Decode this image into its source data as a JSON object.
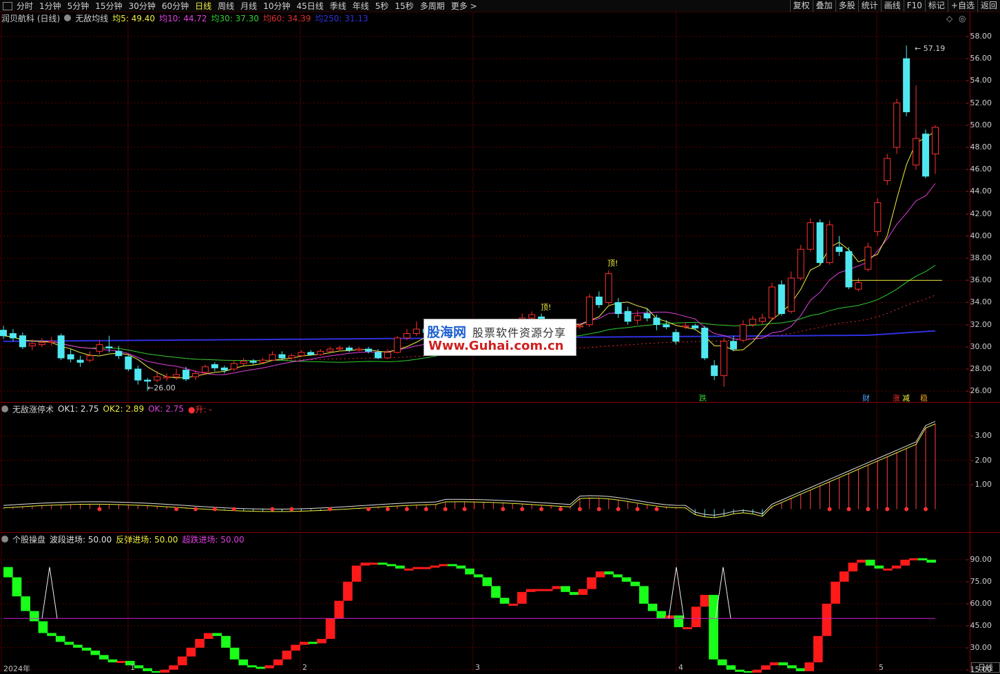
{
  "toolbar": {
    "periods": [
      "分时",
      "1分钟",
      "5分钟",
      "15分钟",
      "30分钟",
      "60分钟",
      "日线",
      "周线",
      "月线",
      "10分钟",
      "45日线",
      "季线",
      "年线",
      "5秒",
      "15秒",
      "多周期",
      "更多 >"
    ],
    "active_period": "日线",
    "tools": [
      "复权",
      "叠加",
      "多股",
      "统计",
      "画线",
      "F10",
      "标记",
      "+自选",
      "返回"
    ]
  },
  "main_panel": {
    "stock": "润贝航科 (日线)",
    "indicator": "无敌均线",
    "ma": [
      {
        "label": "均5: 49.40",
        "color": "#f0f040"
      },
      {
        "label": "均10: 44.72",
        "color": "#e040e0"
      },
      {
        "label": "均30: 37.30",
        "color": "#30d030"
      },
      {
        "label": "均60: 34.39",
        "color": "#e03030"
      },
      {
        "label": "均250: 31.13",
        "color": "#3030e0"
      }
    ],
    "price_axis": [
      "58.00",
      "56.00",
      "54.00",
      "52.00",
      "50.00",
      "48.00",
      "46.00",
      "44.00",
      "42.00",
      "40.00",
      "38.00",
      "36.00",
      "34.00",
      "32.00",
      "30.00",
      "28.00",
      "26.00"
    ],
    "high_label": "57.19",
    "low_label": "26.00",
    "signals": {
      "top": "顶!",
      "down": "跌",
      "cai": "财",
      "zhang": "涨",
      "jian": "减",
      "chou": "稳"
    },
    "period_label": "日线"
  },
  "panel2": {
    "name": "无敌涨停术",
    "ok1": "OK1: 2.75",
    "ok2": "OK2: 2.89",
    "ok": "OK: 2.75",
    "sheng": "●升: -",
    "axis": [
      "3.00",
      "2.00",
      "1.00"
    ]
  },
  "panel3": {
    "name": "个股操盘",
    "wave": "波段进场: 50.00",
    "rebound": "反弹进场: 50.00",
    "oversold": "超跌进场: 50.00",
    "axis": [
      "90.00",
      "75.00",
      "60.00",
      "45.00",
      "30.00",
      "15.00"
    ]
  },
  "dates": [
    "2024年",
    "1",
    "2",
    "3",
    "4",
    "5"
  ],
  "watermark": {
    "brand": "股海网",
    "tag": "股票软件资源分享",
    "url": "Www.Guhai.com.cn"
  },
  "colors": {
    "up": "#ff3030",
    "down": "#50e8f0",
    "ma5": "#f0f040",
    "ma10": "#e040e0",
    "ma30": "#30d030",
    "ma60": "#e03030",
    "ma250": "#3030e0",
    "grid": "#5a0000"
  },
  "chart_data": {
    "type": "candlestick",
    "ylim": [
      25,
      59
    ],
    "candles": [
      {
        "o": 31.5,
        "c": 31.0,
        "h": 31.9,
        "l": 30.7
      },
      {
        "o": 31.2,
        "c": 30.8,
        "h": 31.6,
        "l": 30.5
      },
      {
        "o": 31.0,
        "c": 30.0,
        "h": 31.3,
        "l": 29.8
      },
      {
        "o": 30.1,
        "c": 30.3,
        "h": 30.7,
        "l": 29.7
      },
      {
        "o": 30.2,
        "c": 30.4,
        "h": 30.8,
        "l": 30.0
      },
      {
        "o": 30.4,
        "c": 30.5,
        "h": 30.9,
        "l": 30.1
      },
      {
        "o": 31.0,
        "c": 29.0,
        "h": 31.2,
        "l": 28.8
      },
      {
        "o": 29.3,
        "c": 28.9,
        "h": 29.8,
        "l": 28.6
      },
      {
        "o": 28.8,
        "c": 28.6,
        "h": 29.2,
        "l": 28.2
      },
      {
        "o": 28.8,
        "c": 29.2,
        "h": 29.6,
        "l": 28.6
      },
      {
        "o": 29.6,
        "c": 30.2,
        "h": 30.6,
        "l": 29.3
      },
      {
        "o": 30.0,
        "c": 29.9,
        "h": 31.0,
        "l": 29.5
      },
      {
        "o": 29.6,
        "c": 29.2,
        "h": 30.1,
        "l": 28.9
      },
      {
        "o": 29.1,
        "c": 28.0,
        "h": 29.3,
        "l": 27.8
      },
      {
        "o": 28.0,
        "c": 27.0,
        "h": 28.3,
        "l": 26.6
      },
      {
        "o": 27.0,
        "c": 26.9,
        "h": 27.2,
        "l": 26.0
      },
      {
        "o": 27.0,
        "c": 27.3,
        "h": 27.8,
        "l": 26.8
      },
      {
        "o": 27.2,
        "c": 27.3,
        "h": 27.6,
        "l": 26.9
      },
      {
        "o": 27.3,
        "c": 27.5,
        "h": 28.0,
        "l": 27.0
      },
      {
        "o": 27.9,
        "c": 27.1,
        "h": 28.2,
        "l": 26.9
      },
      {
        "o": 27.3,
        "c": 27.6,
        "h": 27.9,
        "l": 27.0
      },
      {
        "o": 27.7,
        "c": 28.2,
        "h": 28.4,
        "l": 27.5
      },
      {
        "o": 28.4,
        "c": 28.1,
        "h": 28.6,
        "l": 27.8
      },
      {
        "o": 28.1,
        "c": 27.9,
        "h": 28.3,
        "l": 27.6
      },
      {
        "o": 28.0,
        "c": 28.5,
        "h": 28.8,
        "l": 27.8
      },
      {
        "o": 28.5,
        "c": 28.7,
        "h": 29.0,
        "l": 28.3
      },
      {
        "o": 28.7,
        "c": 28.6,
        "h": 28.9,
        "l": 28.4
      },
      {
        "o": 28.6,
        "c": 28.8,
        "h": 29.0,
        "l": 28.5
      },
      {
        "o": 28.8,
        "c": 29.3,
        "h": 29.6,
        "l": 28.7
      },
      {
        "o": 29.3,
        "c": 29.0,
        "h": 29.6,
        "l": 28.8
      },
      {
        "o": 29.0,
        "c": 29.2,
        "h": 29.4,
        "l": 28.9
      },
      {
        "o": 29.2,
        "c": 29.5,
        "h": 29.7,
        "l": 29.1
      },
      {
        "o": 29.5,
        "c": 29.3,
        "h": 29.7,
        "l": 29.2
      },
      {
        "o": 29.3,
        "c": 29.6,
        "h": 29.8,
        "l": 29.2
      },
      {
        "o": 29.6,
        "c": 29.8,
        "h": 30.0,
        "l": 29.5
      },
      {
        "o": 29.8,
        "c": 29.9,
        "h": 30.1,
        "l": 29.6
      },
      {
        "o": 29.9,
        "c": 29.7,
        "h": 30.1,
        "l": 29.5
      },
      {
        "o": 29.7,
        "c": 29.8,
        "h": 30.0,
        "l": 29.6
      },
      {
        "o": 29.8,
        "c": 29.6,
        "h": 30.0,
        "l": 29.4
      },
      {
        "o": 29.5,
        "c": 29.0,
        "h": 29.8,
        "l": 28.9
      },
      {
        "o": 29.0,
        "c": 29.5,
        "h": 29.8,
        "l": 28.9
      },
      {
        "o": 29.5,
        "c": 30.8,
        "h": 31.0,
        "l": 29.4
      },
      {
        "o": 30.8,
        "c": 31.2,
        "h": 31.6,
        "l": 30.6
      },
      {
        "o": 31.2,
        "c": 31.6,
        "h": 32.3,
        "l": 31.0
      },
      {
        "o": 31.6,
        "c": 31.3,
        "h": 31.9,
        "l": 31.1
      },
      {
        "o": 31.3,
        "c": 31.5,
        "h": 31.8,
        "l": 31.1
      },
      {
        "o": 31.5,
        "c": 31.4,
        "h": 31.7,
        "l": 31.2
      },
      {
        "o": 31.4,
        "c": 31.6,
        "h": 31.9,
        "l": 31.2
      },
      {
        "o": 31.6,
        "c": 31.3,
        "h": 31.8,
        "l": 31.1
      },
      {
        "o": 31.3,
        "c": 31.5,
        "h": 31.8,
        "l": 31.2
      },
      {
        "o": 31.5,
        "c": 31.7,
        "h": 32.0,
        "l": 31.3
      },
      {
        "o": 31.7,
        "c": 31.6,
        "h": 31.9,
        "l": 31.4
      },
      {
        "o": 31.6,
        "c": 31.8,
        "h": 32.0,
        "l": 31.4
      },
      {
        "o": 31.8,
        "c": 32.0,
        "h": 32.4,
        "l": 31.6
      },
      {
        "o": 32.0,
        "c": 32.6,
        "h": 33.0,
        "l": 31.8
      },
      {
        "o": 32.6,
        "c": 32.9,
        "h": 33.2,
        "l": 32.4
      },
      {
        "o": 32.7,
        "c": 32.5,
        "h": 33.0,
        "l": 32.2
      },
      {
        "o": 32.2,
        "c": 32.0,
        "h": 32.5,
        "l": 31.8
      },
      {
        "o": 32.0,
        "c": 31.6,
        "h": 32.4,
        "l": 31.5
      },
      {
        "o": 31.7,
        "c": 31.8,
        "h": 32.0,
        "l": 31.5
      },
      {
        "o": 31.8,
        "c": 31.9,
        "h": 32.1,
        "l": 31.6
      },
      {
        "o": 32.0,
        "c": 34.5,
        "h": 34.8,
        "l": 31.8
      },
      {
        "o": 34.5,
        "c": 33.8,
        "h": 35.0,
        "l": 33.5
      },
      {
        "o": 34.0,
        "c": 36.6,
        "h": 36.9,
        "l": 33.8
      },
      {
        "o": 34.0,
        "c": 33.0,
        "h": 34.4,
        "l": 32.6
      },
      {
        "o": 33.2,
        "c": 32.3,
        "h": 33.6,
        "l": 32.0
      },
      {
        "o": 32.4,
        "c": 32.8,
        "h": 33.3,
        "l": 32.0
      },
      {
        "o": 33.0,
        "c": 32.6,
        "h": 33.5,
        "l": 32.3
      },
      {
        "o": 32.6,
        "c": 32.0,
        "h": 32.9,
        "l": 31.5
      },
      {
        "o": 32.0,
        "c": 31.8,
        "h": 32.4,
        "l": 31.6
      },
      {
        "o": 31.3,
        "c": 30.5,
        "h": 31.6,
        "l": 30.2
      },
      {
        "o": 31.8,
        "c": 31.9,
        "h": 32.2,
        "l": 31.6
      },
      {
        "o": 31.9,
        "c": 31.7,
        "h": 32.1,
        "l": 31.5
      },
      {
        "o": 31.7,
        "c": 29.0,
        "h": 31.9,
        "l": 28.8
      },
      {
        "o": 28.3,
        "c": 27.4,
        "h": 28.8,
        "l": 27.0
      },
      {
        "o": 27.4,
        "c": 30.5,
        "h": 30.8,
        "l": 26.4
      },
      {
        "o": 30.5,
        "c": 29.8,
        "h": 31.0,
        "l": 29.6
      },
      {
        "o": 30.6,
        "c": 32.0,
        "h": 32.4,
        "l": 30.4
      },
      {
        "o": 32.0,
        "c": 32.5,
        "h": 32.8,
        "l": 31.8
      },
      {
        "o": 32.3,
        "c": 32.6,
        "h": 33.0,
        "l": 32.0
      },
      {
        "o": 32.6,
        "c": 35.4,
        "h": 35.8,
        "l": 32.4
      },
      {
        "o": 35.6,
        "c": 33.0,
        "h": 36.0,
        "l": 32.8
      },
      {
        "o": 33.2,
        "c": 36.2,
        "h": 36.8,
        "l": 33.0
      },
      {
        "o": 36.2,
        "c": 38.8,
        "h": 39.2,
        "l": 36.0
      },
      {
        "o": 38.8,
        "c": 41.2,
        "h": 41.6,
        "l": 38.6
      },
      {
        "o": 41.2,
        "c": 37.6,
        "h": 41.5,
        "l": 37.4
      },
      {
        "o": 37.6,
        "c": 41.0,
        "h": 41.4,
        "l": 37.4
      },
      {
        "o": 39.0,
        "c": 38.6,
        "h": 40.0,
        "l": 38.2
      },
      {
        "o": 38.6,
        "c": 35.4,
        "h": 39.0,
        "l": 35.2
      },
      {
        "o": 35.2,
        "c": 35.8,
        "h": 36.2,
        "l": 35.0
      },
      {
        "o": 37.0,
        "c": 39.0,
        "h": 39.4,
        "l": 36.8
      },
      {
        "o": 40.4,
        "c": 43.0,
        "h": 43.4,
        "l": 40.0
      },
      {
        "o": 45.0,
        "c": 47.0,
        "h": 47.4,
        "l": 44.6
      },
      {
        "o": 48.0,
        "c": 52.0,
        "h": 52.4,
        "l": 47.4
      },
      {
        "o": 56.0,
        "c": 51.2,
        "h": 57.19,
        "l": 50.8
      },
      {
        "o": 46.4,
        "c": 48.8,
        "h": 53.6,
        "l": 46.0
      },
      {
        "o": 49.2,
        "c": 45.4,
        "h": 49.6,
        "l": 45.2
      },
      {
        "o": 47.4,
        "c": 49.8,
        "h": 50.0,
        "l": 45.6
      }
    ]
  }
}
